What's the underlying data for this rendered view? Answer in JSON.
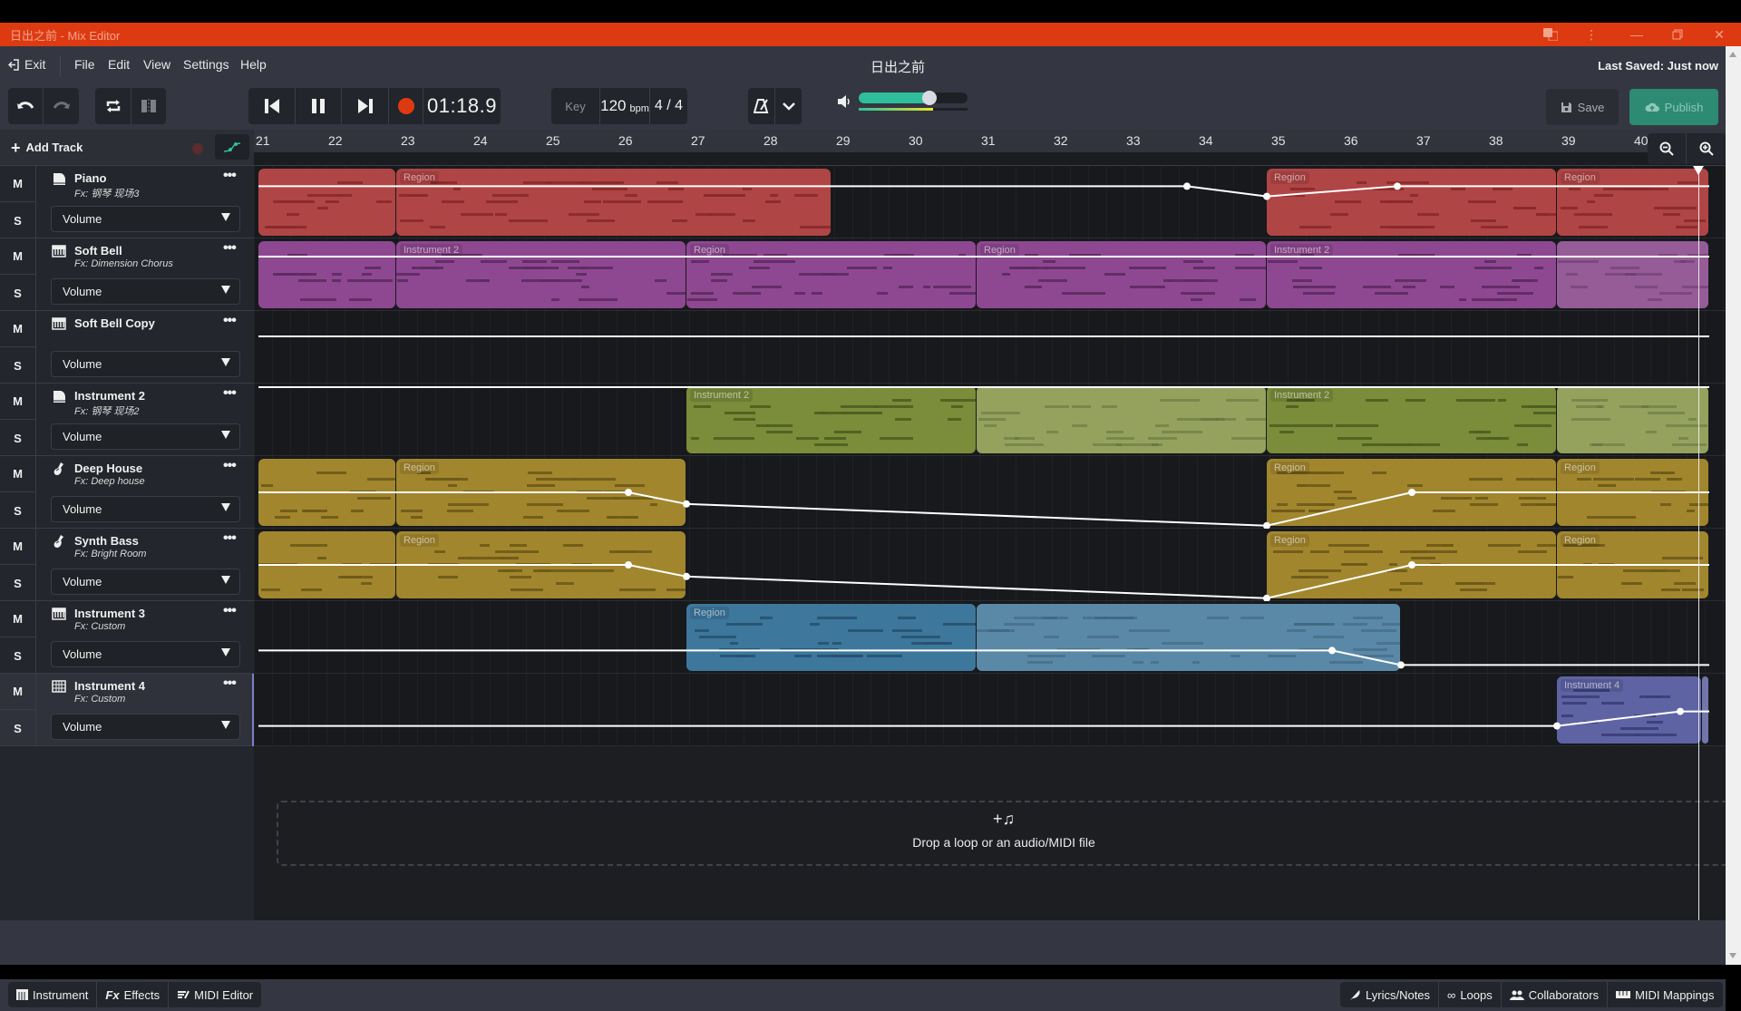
{
  "window": {
    "title": "日出之前 - Mix Editor",
    "controls": [
      "translate-icon",
      "more-vertical-icon",
      "minimize-icon",
      "restore-icon",
      "close-icon"
    ]
  },
  "menu": {
    "exit": "Exit",
    "items": [
      "File",
      "Edit",
      "View",
      "Settings",
      "Help"
    ]
  },
  "header": {
    "song_title": "日出之前",
    "last_saved": "Last Saved: Just now"
  },
  "toolbar": {
    "undo": "undo-icon",
    "redo": "redo-icon",
    "loop": "loop-icon",
    "split": "split-icon",
    "transport": [
      "skip-back-icon",
      "pause-icon",
      "skip-forward-icon",
      "record-icon"
    ],
    "time": "01:18.9",
    "key_label": "Key",
    "tempo": "120",
    "tempo_unit": "bpm",
    "time_signature": "4 / 4",
    "metronome": "metronome-icon",
    "dropdown": "chevron-down-icon",
    "master_volume_percent": 65,
    "level_meter_percent": 68,
    "save_label": "Save",
    "publish_label": "Publish"
  },
  "colors": {
    "titlebar": "#de3a12",
    "accent": "#2fbe9b",
    "publish": "#2d8a73",
    "record": "#de3a12"
  },
  "add_track_label": "Add Track",
  "ruler": {
    "bars": [
      "21",
      "22",
      "23",
      "24",
      "25",
      "26",
      "27",
      "28",
      "29",
      "30",
      "31",
      "32",
      "33",
      "34",
      "35",
      "36",
      "37",
      "38",
      "39",
      "40"
    ]
  },
  "tracks": [
    {
      "name": "Piano",
      "fx": "Fx: 钢琴 现场3",
      "icon": "piano-icon",
      "param": "Volume",
      "color": "#b04545",
      "note": "#8a2a2a",
      "regions": [
        {
          "label": "",
          "start": 21,
          "end": 22.9
        },
        {
          "label": "Region",
          "start": 22.9,
          "end": 28.9
        },
        {
          "label": "Region",
          "start": 34.9,
          "end": 38.9
        },
        {
          "label": "Region",
          "start": 38.9,
          "end": 41
        }
      ]
    },
    {
      "name": "Soft Bell",
      "fx": "Fx: Dimension Chorus",
      "icon": "keyboard-icon",
      "param": "Volume",
      "color": "#8e4891",
      "note": "#5e2a62",
      "regions": [
        {
          "label": "",
          "start": 21,
          "end": 22.9
        },
        {
          "label": "Instrument 2",
          "start": 22.9,
          "end": 26.9
        },
        {
          "label": "Region",
          "start": 26.9,
          "end": 30.9
        },
        {
          "label": "Region",
          "start": 30.9,
          "end": 34.9
        },
        {
          "label": "Instrument 2",
          "start": 34.9,
          "end": 38.9
        },
        {
          "label": "",
          "start": 38.9,
          "end": 41,
          "ghost": true
        }
      ]
    },
    {
      "name": "Soft Bell Copy",
      "fx": "",
      "icon": "keyboard-icon",
      "param": "Volume",
      "color": "",
      "note": "",
      "regions": []
    },
    {
      "name": "Instrument 2",
      "fx": "Fx: 钢琴 现场2",
      "icon": "piano-icon",
      "param": "Volume",
      "color": "#7b8c3a",
      "note": "#4f5e20",
      "regions": [
        {
          "label": "Instrument 2",
          "start": 26.9,
          "end": 30.9
        },
        {
          "label": "",
          "start": 30.9,
          "end": 34.9,
          "ghost": true
        },
        {
          "label": "Instrument 2",
          "start": 34.9,
          "end": 38.9
        },
        {
          "label": "",
          "start": 38.9,
          "end": 41,
          "ghost": true
        }
      ]
    },
    {
      "name": "Deep House",
      "fx": "Fx: Deep house",
      "icon": "guitar-icon",
      "param": "Volume",
      "color": "#a2862e",
      "note": "#6e5a18",
      "regions": [
        {
          "label": "",
          "start": 21,
          "end": 22.9
        },
        {
          "label": "Region",
          "start": 22.9,
          "end": 26.9
        },
        {
          "label": "Region",
          "start": 34.9,
          "end": 38.9
        },
        {
          "label": "Region",
          "start": 38.9,
          "end": 41
        }
      ]
    },
    {
      "name": "Synth Bass",
      "fx": "Fx: Bright Room",
      "icon": "guitar-icon",
      "param": "Volume",
      "color": "#a2862e",
      "note": "#6e5a18",
      "regions": [
        {
          "label": "",
          "start": 21,
          "end": 22.9
        },
        {
          "label": "Region",
          "start": 22.9,
          "end": 26.9
        },
        {
          "label": "Region",
          "start": 34.9,
          "end": 38.9
        },
        {
          "label": "Region",
          "start": 38.9,
          "end": 41
        }
      ]
    },
    {
      "name": "Instrument 3",
      "fx": "Fx: Custom",
      "icon": "keyboard-icon",
      "param": "Volume",
      "color": "#3e779c",
      "note": "#265270",
      "regions": [
        {
          "label": "Region",
          "start": 26.9,
          "end": 30.9
        },
        {
          "label": "",
          "start": 30.9,
          "end": 36.75,
          "ghost": true
        }
      ]
    },
    {
      "name": "Instrument 4",
      "fx": "Fx: Custom",
      "icon": "grid-icon",
      "param": "Volume",
      "color": "#5e63a3",
      "note": "#3a3e78",
      "selected": true,
      "regions": [
        {
          "label": "Instrument 4",
          "start": 38.9,
          "end": 40.9
        },
        {
          "label": "",
          "start": 40.9,
          "end": 41,
          "ghost": true
        }
      ]
    }
  ],
  "automation": [
    [
      [
        21,
        0.28
      ],
      [
        33.8,
        0.28
      ],
      [
        34.9,
        0.42
      ],
      [
        36.7,
        0.28
      ],
      [
        41,
        0.28
      ]
    ],
    [
      [
        21,
        0.25
      ],
      [
        41,
        0.25
      ]
    ],
    [
      [
        21,
        0.35
      ],
      [
        41,
        0.35
      ]
    ],
    [
      [
        21,
        0.05
      ],
      [
        41,
        0.05
      ]
    ],
    [
      [
        21,
        0.5
      ],
      [
        26.1,
        0.5
      ],
      [
        26.9,
        0.66
      ],
      [
        34.9,
        0.96
      ],
      [
        36.9,
        0.5
      ],
      [
        41,
        0.5
      ]
    ],
    [
      [
        21,
        0.5
      ],
      [
        26.1,
        0.5
      ],
      [
        26.9,
        0.66
      ],
      [
        34.9,
        0.96
      ],
      [
        36.9,
        0.5
      ],
      [
        41,
        0.5
      ]
    ],
    [
      [
        21,
        0.68
      ],
      [
        35.8,
        0.68
      ],
      [
        36.75,
        0.88
      ],
      [
        41,
        0.88
      ]
    ],
    [
      [
        21,
        0.72
      ],
      [
        38.9,
        0.72
      ],
      [
        40.6,
        0.52
      ],
      [
        41,
        0.52
      ]
    ]
  ],
  "playhead_bar": 40.85,
  "dropzone": {
    "icon": "add-music-icon",
    "text": "Drop a loop or an audio/MIDI file"
  },
  "bottom_left": [
    {
      "icon": "instrument-icon",
      "label": "Instrument"
    },
    {
      "icon": "fx-icon",
      "label": "Effects"
    },
    {
      "icon": "midi-editor-icon",
      "label": "MIDI Editor"
    }
  ],
  "bottom_right": [
    {
      "icon": "feather-icon",
      "label": "Lyrics/Notes"
    },
    {
      "icon": "infinity-icon",
      "label": "Loops"
    },
    {
      "icon": "users-icon",
      "label": "Collaborators"
    },
    {
      "icon": "midi-keyboard-icon",
      "label": "MIDI Mappings"
    }
  ]
}
